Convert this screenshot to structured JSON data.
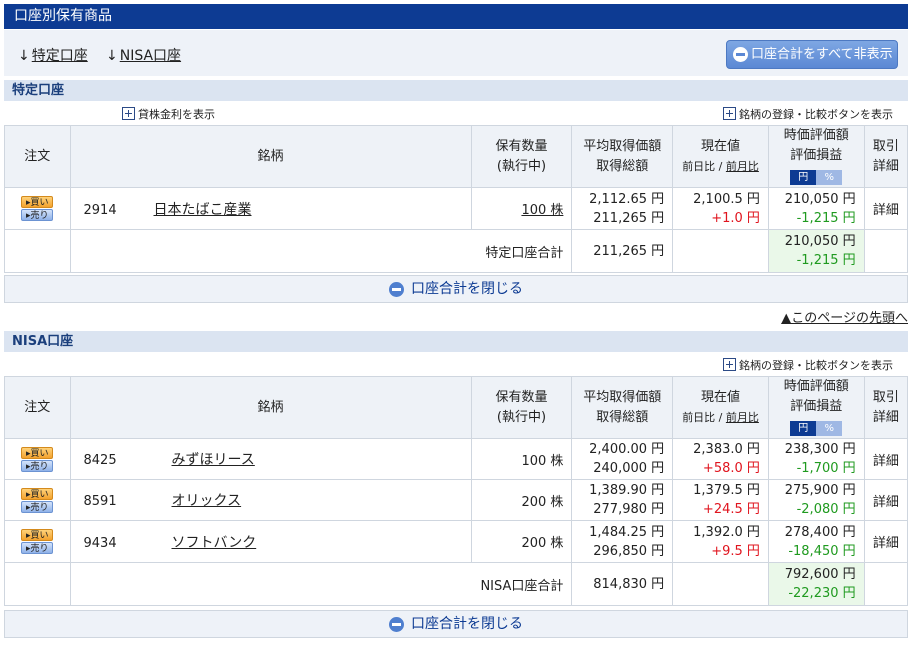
{
  "page_title": "口座別保有商品",
  "nav": {
    "link_tokutei": "特定口座",
    "link_nisa": "NISA口座",
    "arrow": "↓",
    "hide_all_button": "口座合計をすべて非表示"
  },
  "headers": {
    "order": "注文",
    "stock": "銘柄",
    "qty_line1": "保有数量",
    "qty_line2": "(執行中)",
    "avg_line1": "平均取得価額",
    "avg_line2": "取得総額",
    "price_line1": "現在値",
    "price_line2a": "前日比",
    "price_sep": " / ",
    "price_line2b": "前月比",
    "value_line1": "時価評価額",
    "value_line2": "評価損益",
    "toggle_yen": "円",
    "toggle_pct": "%",
    "detail_line1": "取引",
    "detail_line2": "詳細"
  },
  "order_buttons": {
    "buy": "▸買い",
    "sell": "▸売り"
  },
  "detail_label": "詳細",
  "tokutei": {
    "section_title": "特定口座",
    "lending_link": "貸株金利を表示",
    "register_link": "銘柄の登録・比較ボタンを表示",
    "rows": [
      {
        "code": "2914",
        "name": "日本たばこ産業",
        "qty": "100 株",
        "avg_price": "2,112.65 円",
        "total_cost": "211,265 円",
        "price": "2,100.5 円",
        "change": "+1.0 円",
        "value": "210,050 円",
        "pl": "-1,215 円"
      }
    ],
    "total": {
      "label": "特定口座合計",
      "total_cost": "211,265 円",
      "value": "210,050 円",
      "pl": "-1,215 円"
    },
    "close_label": "口座合計を閉じる",
    "page_top": "▲このページの先頭へ"
  },
  "nisa": {
    "section_title": "NISA口座",
    "register_link": "銘柄の登録・比較ボタンを表示",
    "rows": [
      {
        "code": "8425",
        "name": "みずほリース",
        "qty": "100 株",
        "avg_price": "2,400.00 円",
        "total_cost": "240,000 円",
        "price": "2,383.0 円",
        "change": "+58.0 円",
        "value": "238,300 円",
        "pl": "-1,700 円"
      },
      {
        "code": "8591",
        "name": "オリックス",
        "qty": "200 株",
        "avg_price": "1,389.90 円",
        "total_cost": "277,980 円",
        "price": "1,379.5 円",
        "change": "+24.5 円",
        "value": "275,900 円",
        "pl": "-2,080 円"
      },
      {
        "code": "9434",
        "name": "ソフトバンク",
        "qty": "200 株",
        "avg_price": "1,484.25 円",
        "total_cost": "296,850 円",
        "price": "1,392.0 円",
        "change": "+9.5 円",
        "value": "278,400 円",
        "pl": "-18,450 円"
      }
    ],
    "total": {
      "label": "NISA口座合計",
      "total_cost": "814,830 円",
      "value": "792,600 円",
      "pl": "-22,230 円"
    },
    "close_label": "口座合計を閉じる"
  },
  "colors": {
    "title_bar": "#0d3b93",
    "positive": "#e0141e",
    "negative": "#1f9a1f",
    "section_header": "#dbe4f1"
  }
}
